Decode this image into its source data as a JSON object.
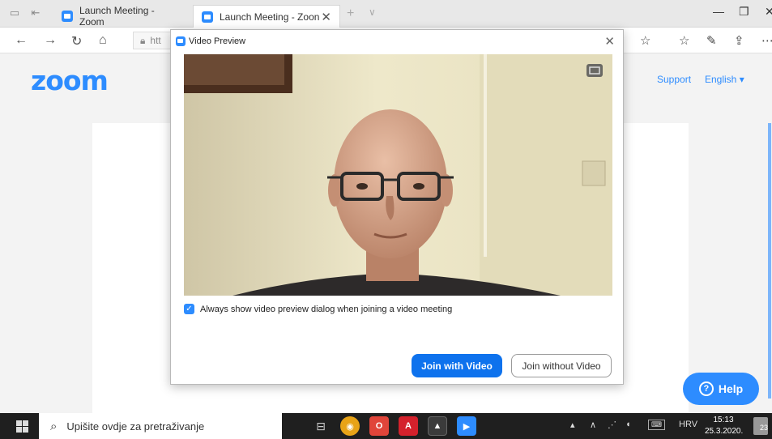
{
  "browser": {
    "tabs": [
      {
        "title": "Launch Meeting - Zoom",
        "active": false
      },
      {
        "title": "Launch Meeting - Zoon",
        "active": true
      }
    ],
    "address_prefix": "htt"
  },
  "zoom_page": {
    "logo": "zoom",
    "nav": {
      "support": "Support",
      "language": "English ▾"
    },
    "help_label": "Help",
    "help_icon": "?"
  },
  "dialog": {
    "title": "Video Preview",
    "checkbox_label": "Always show video preview dialog when joining a video meeting",
    "checkbox_checked": true,
    "join_with_video": "Join with Video",
    "join_without_video": "Join without Video"
  },
  "taskbar": {
    "search_placeholder": "Upišite ovdje za pretraživanje",
    "language": "HRV",
    "time": "15:13",
    "date": "25.3.2020.",
    "notification_count": "23"
  },
  "colors": {
    "zoom_blue": "#2d8cff",
    "primary_button": "#0e72ed",
    "taskbar": "#1f1f1f"
  }
}
